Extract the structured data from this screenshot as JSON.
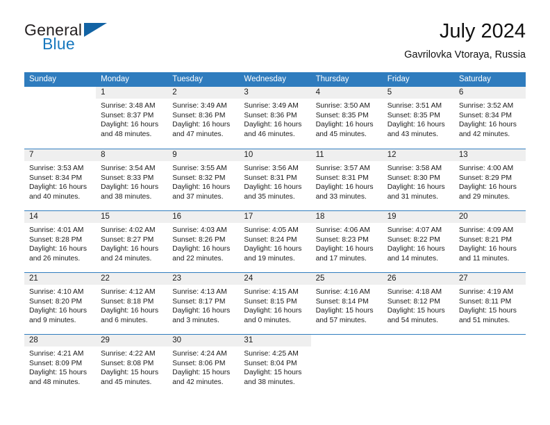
{
  "brand": {
    "name_part1": "General",
    "name_part2": "Blue",
    "triangle_color": "#1263a4",
    "blue_color": "#1878be"
  },
  "header": {
    "month_title": "July 2024",
    "location": "Gavrilovka Vtoraya, Russia",
    "header_bg": "#2f7cbe",
    "date_band_bg": "#efefef"
  },
  "weekday_headers": [
    "Sunday",
    "Monday",
    "Tuesday",
    "Wednesday",
    "Thursday",
    "Friday",
    "Saturday"
  ],
  "weeks": [
    [
      {
        "day": "",
        "lines": []
      },
      {
        "day": "1",
        "lines": [
          "Sunrise: 3:48 AM",
          "Sunset: 8:37 PM",
          "Daylight: 16 hours",
          "and 48 minutes."
        ]
      },
      {
        "day": "2",
        "lines": [
          "Sunrise: 3:49 AM",
          "Sunset: 8:36 PM",
          "Daylight: 16 hours",
          "and 47 minutes."
        ]
      },
      {
        "day": "3",
        "lines": [
          "Sunrise: 3:49 AM",
          "Sunset: 8:36 PM",
          "Daylight: 16 hours",
          "and 46 minutes."
        ]
      },
      {
        "day": "4",
        "lines": [
          "Sunrise: 3:50 AM",
          "Sunset: 8:35 PM",
          "Daylight: 16 hours",
          "and 45 minutes."
        ]
      },
      {
        "day": "5",
        "lines": [
          "Sunrise: 3:51 AM",
          "Sunset: 8:35 PM",
          "Daylight: 16 hours",
          "and 43 minutes."
        ]
      },
      {
        "day": "6",
        "lines": [
          "Sunrise: 3:52 AM",
          "Sunset: 8:34 PM",
          "Daylight: 16 hours",
          "and 42 minutes."
        ]
      }
    ],
    [
      {
        "day": "7",
        "lines": [
          "Sunrise: 3:53 AM",
          "Sunset: 8:34 PM",
          "Daylight: 16 hours",
          "and 40 minutes."
        ]
      },
      {
        "day": "8",
        "lines": [
          "Sunrise: 3:54 AM",
          "Sunset: 8:33 PM",
          "Daylight: 16 hours",
          "and 38 minutes."
        ]
      },
      {
        "day": "9",
        "lines": [
          "Sunrise: 3:55 AM",
          "Sunset: 8:32 PM",
          "Daylight: 16 hours",
          "and 37 minutes."
        ]
      },
      {
        "day": "10",
        "lines": [
          "Sunrise: 3:56 AM",
          "Sunset: 8:31 PM",
          "Daylight: 16 hours",
          "and 35 minutes."
        ]
      },
      {
        "day": "11",
        "lines": [
          "Sunrise: 3:57 AM",
          "Sunset: 8:31 PM",
          "Daylight: 16 hours",
          "and 33 minutes."
        ]
      },
      {
        "day": "12",
        "lines": [
          "Sunrise: 3:58 AM",
          "Sunset: 8:30 PM",
          "Daylight: 16 hours",
          "and 31 minutes."
        ]
      },
      {
        "day": "13",
        "lines": [
          "Sunrise: 4:00 AM",
          "Sunset: 8:29 PM",
          "Daylight: 16 hours",
          "and 29 minutes."
        ]
      }
    ],
    [
      {
        "day": "14",
        "lines": [
          "Sunrise: 4:01 AM",
          "Sunset: 8:28 PM",
          "Daylight: 16 hours",
          "and 26 minutes."
        ]
      },
      {
        "day": "15",
        "lines": [
          "Sunrise: 4:02 AM",
          "Sunset: 8:27 PM",
          "Daylight: 16 hours",
          "and 24 minutes."
        ]
      },
      {
        "day": "16",
        "lines": [
          "Sunrise: 4:03 AM",
          "Sunset: 8:26 PM",
          "Daylight: 16 hours",
          "and 22 minutes."
        ]
      },
      {
        "day": "17",
        "lines": [
          "Sunrise: 4:05 AM",
          "Sunset: 8:24 PM",
          "Daylight: 16 hours",
          "and 19 minutes."
        ]
      },
      {
        "day": "18",
        "lines": [
          "Sunrise: 4:06 AM",
          "Sunset: 8:23 PM",
          "Daylight: 16 hours",
          "and 17 minutes."
        ]
      },
      {
        "day": "19",
        "lines": [
          "Sunrise: 4:07 AM",
          "Sunset: 8:22 PM",
          "Daylight: 16 hours",
          "and 14 minutes."
        ]
      },
      {
        "day": "20",
        "lines": [
          "Sunrise: 4:09 AM",
          "Sunset: 8:21 PM",
          "Daylight: 16 hours",
          "and 11 minutes."
        ]
      }
    ],
    [
      {
        "day": "21",
        "lines": [
          "Sunrise: 4:10 AM",
          "Sunset: 8:20 PM",
          "Daylight: 16 hours",
          "and 9 minutes."
        ]
      },
      {
        "day": "22",
        "lines": [
          "Sunrise: 4:12 AM",
          "Sunset: 8:18 PM",
          "Daylight: 16 hours",
          "and 6 minutes."
        ]
      },
      {
        "day": "23",
        "lines": [
          "Sunrise: 4:13 AM",
          "Sunset: 8:17 PM",
          "Daylight: 16 hours",
          "and 3 minutes."
        ]
      },
      {
        "day": "24",
        "lines": [
          "Sunrise: 4:15 AM",
          "Sunset: 8:15 PM",
          "Daylight: 16 hours",
          "and 0 minutes."
        ]
      },
      {
        "day": "25",
        "lines": [
          "Sunrise: 4:16 AM",
          "Sunset: 8:14 PM",
          "Daylight: 15 hours",
          "and 57 minutes."
        ]
      },
      {
        "day": "26",
        "lines": [
          "Sunrise: 4:18 AM",
          "Sunset: 8:12 PM",
          "Daylight: 15 hours",
          "and 54 minutes."
        ]
      },
      {
        "day": "27",
        "lines": [
          "Sunrise: 4:19 AM",
          "Sunset: 8:11 PM",
          "Daylight: 15 hours",
          "and 51 minutes."
        ]
      }
    ],
    [
      {
        "day": "28",
        "lines": [
          "Sunrise: 4:21 AM",
          "Sunset: 8:09 PM",
          "Daylight: 15 hours",
          "and 48 minutes."
        ]
      },
      {
        "day": "29",
        "lines": [
          "Sunrise: 4:22 AM",
          "Sunset: 8:08 PM",
          "Daylight: 15 hours",
          "and 45 minutes."
        ]
      },
      {
        "day": "30",
        "lines": [
          "Sunrise: 4:24 AM",
          "Sunset: 8:06 PM",
          "Daylight: 15 hours",
          "and 42 minutes."
        ]
      },
      {
        "day": "31",
        "lines": [
          "Sunrise: 4:25 AM",
          "Sunset: 8:04 PM",
          "Daylight: 15 hours",
          "and 38 minutes."
        ]
      },
      {
        "day": "",
        "lines": []
      },
      {
        "day": "",
        "lines": []
      },
      {
        "day": "",
        "lines": []
      }
    ]
  ]
}
